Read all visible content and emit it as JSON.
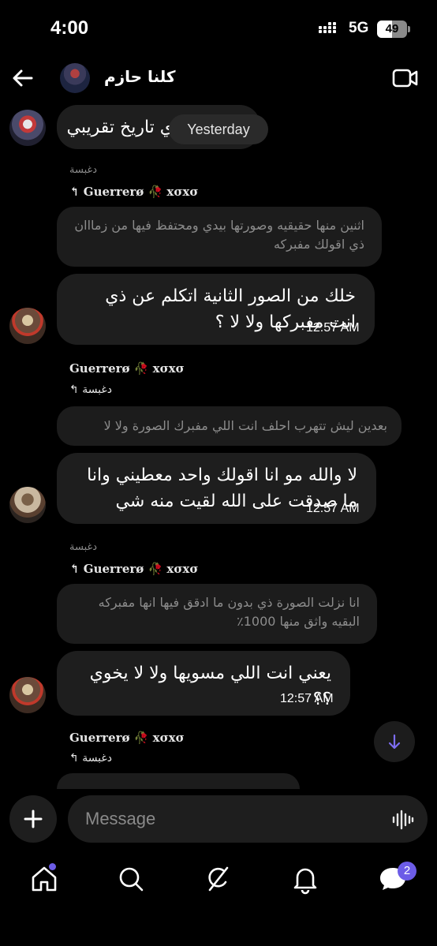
{
  "status_bar": {
    "time": "4:00",
    "network": "5G",
    "battery_percent": "49",
    "battery_level": 0.49
  },
  "header": {
    "title": "كلنا حازم"
  },
  "date_separator": "Yesterday",
  "messages": [
    {
      "text": "ي تاريخ تقريبي"
    },
    {
      "reply_to_name": "دغبسة",
      "reply_context": "Guerrerø 🥀 xσxσ",
      "quoted": "اثنين منها حقيقيه وصورتها بيدي ومحتفظ فيها من زمااان ذي اقولك مفبركه",
      "text": "خلك من الصور الثانية اتكلم عن ذي انت مفبركها ولا لا ؟",
      "time": "12:57 AM"
    },
    {
      "reply_context": "Guerrerø 🥀 xσxσ",
      "reply_to_name": "دغبسة",
      "quoted": "بعدين ليش تتهرب احلف انت اللي مفبرك الصورة ولا لا",
      "text": "لا والله مو انا اقولك واحد معطيني وانا ما صدقت على الله لقيت منه شي",
      "time": "12:57 AM"
    },
    {
      "reply_to_name": "دغبسة",
      "reply_context": "Guerrerø 🥀 xσxσ",
      "quoted": "انا نزلت الصورة ذي بدون ما ادقق فيها انها مفبركه البقيه واثق منها 1000٪",
      "text": "يعني انت اللي مسويها ولا لا يخوي ؟؟",
      "time": "12:57 AM"
    },
    {
      "reply_context": "Guerrerø 🥀 xσxσ",
      "reply_to_name": "دغبسة"
    }
  ],
  "composer": {
    "placeholder": "Message"
  },
  "tabbar": {
    "notifications_badge": "2"
  },
  "colors": {
    "accent": "#6c5ce7",
    "bubble": "#1e1e1e",
    "background": "#000000"
  },
  "icons": [
    "back-arrow-icon",
    "video-call-icon",
    "plus-icon",
    "voice-message-icon",
    "home-icon",
    "search-icon",
    "grok-icon",
    "bell-icon",
    "messages-icon",
    "arrow-down-icon"
  ]
}
